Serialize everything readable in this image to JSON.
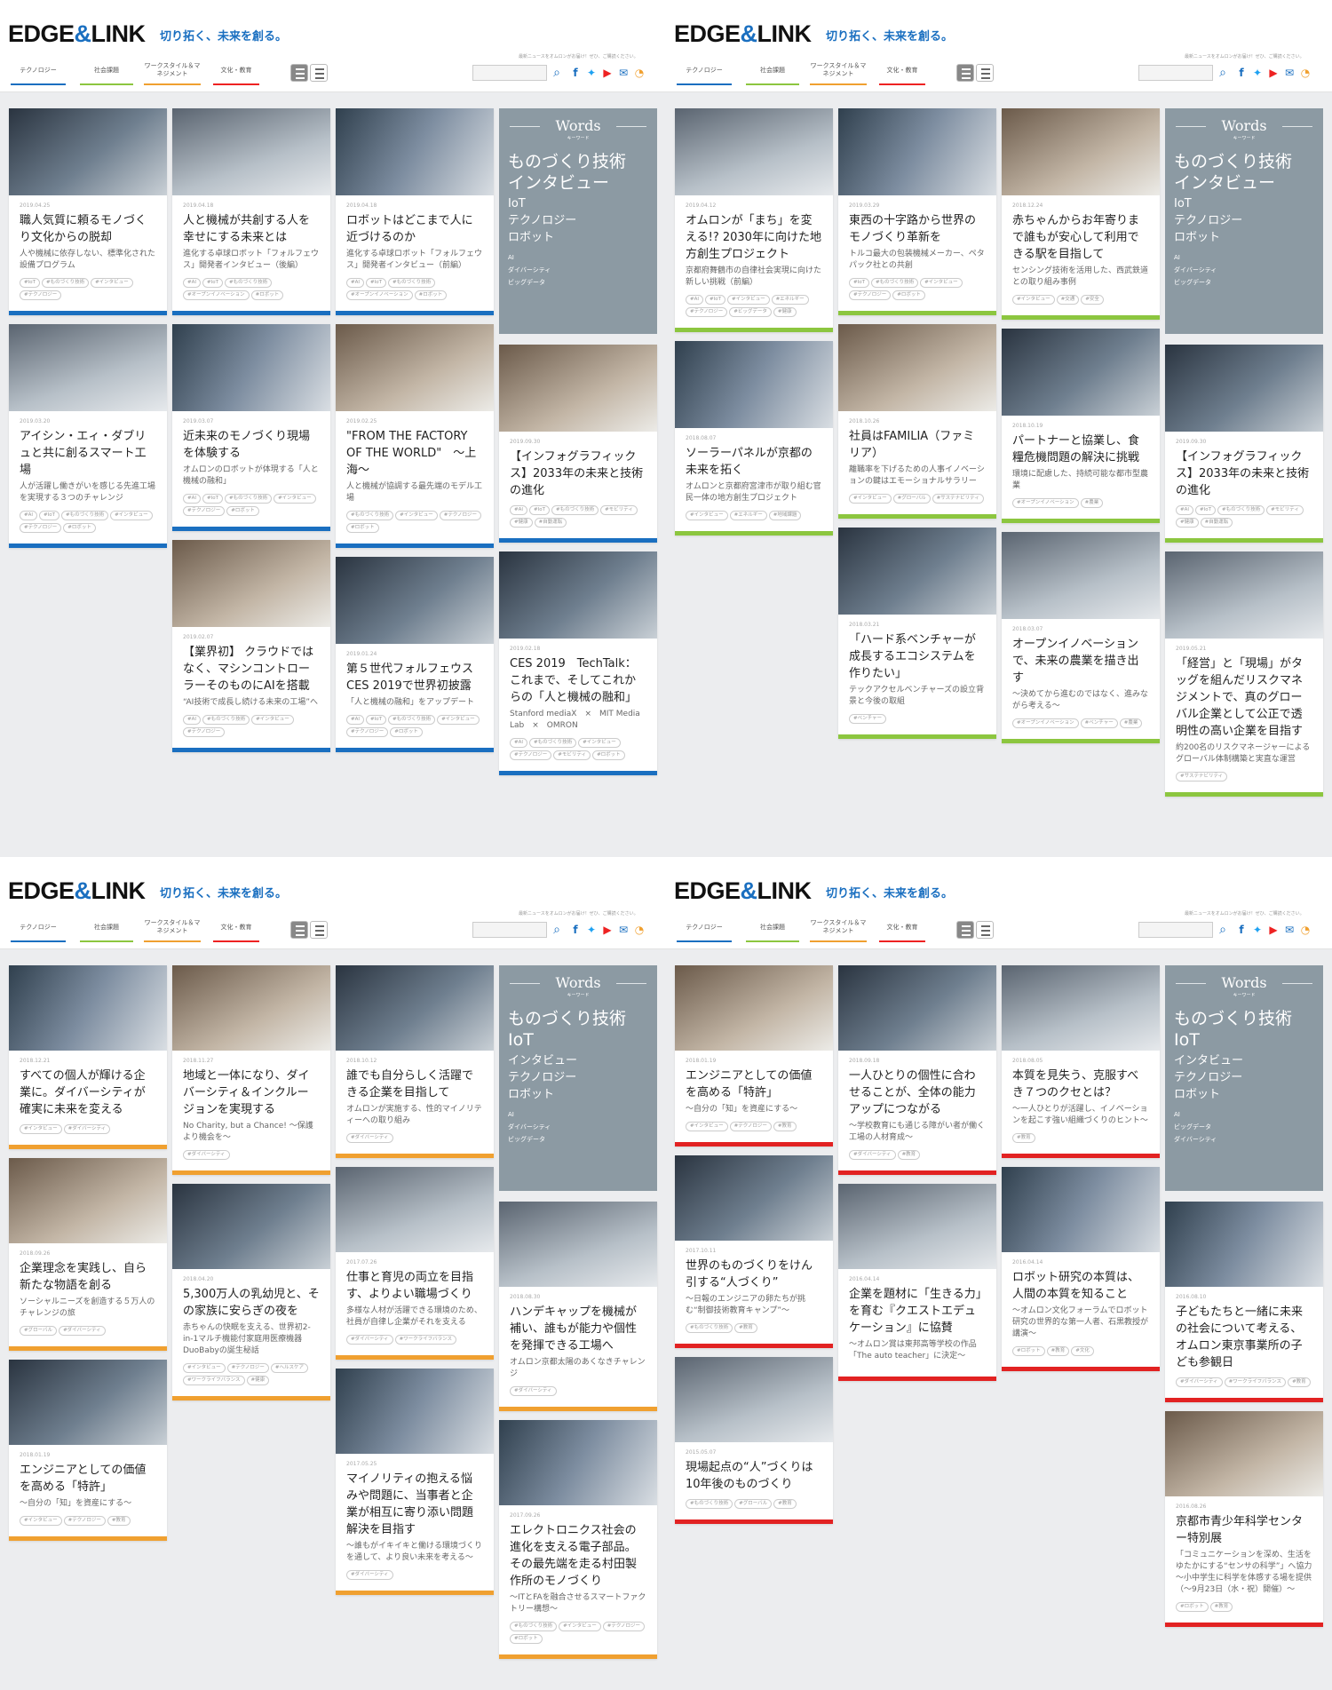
{
  "site": {
    "logo": "EDGE",
    "amp": "&",
    "logo2": "LINK",
    "tagline": "切り拓く、未来を創る。",
    "note": "最新ニュースをオムロンがお届け！ぜひ、ご購読ください。",
    "nav": [
      "テクノロジー",
      "社会課題",
      "ワークスタイル＆マネジメント",
      "文化・教育"
    ],
    "icons": [
      "search-icon",
      "facebook-icon",
      "twitter-icon",
      "youtube-icon",
      "mail-icon",
      "rss-icon"
    ],
    "colors": {
      "tech": "#1a6fc0",
      "social": "#8cc63f",
      "work": "#f0a030",
      "culture": "#e22222"
    }
  },
  "words": {
    "q1": {
      "en": "Words",
      "jp": "キーワード",
      "lg": [
        "ものづくり技術",
        "インタビュー"
      ],
      "md": [
        "IoT",
        "テクノロジー",
        "ロボット"
      ],
      "sm": [
        "AI",
        "ダイバーシティ",
        "ビッグデータ"
      ]
    },
    "q2": {
      "en": "Words",
      "jp": "キーワード",
      "lg": [
        "ものづくり技術",
        "インタビュー"
      ],
      "md": [
        "IoT",
        "テクノロジー",
        "ロボット"
      ],
      "sm": [
        "AI",
        "ダイバーシティ",
        "ビッグデータ"
      ]
    },
    "q3": {
      "en": "Words",
      "jp": "キーワード",
      "lg": [
        "ものづくり技術",
        "IoT"
      ],
      "md": [
        "インタビュー",
        "テクノロジー",
        "ロボット"
      ],
      "sm": [
        "AI",
        "ダイバーシティ",
        "ビッグデータ"
      ]
    },
    "q4": {
      "en": "Words",
      "jp": "キーワード",
      "lg": [
        "ものづくり技術",
        "IoT"
      ],
      "md": [
        "インタビュー",
        "テクノロジー",
        "ロボット"
      ],
      "sm": [
        "AI",
        "ビッグデータ",
        "ダイバーシティ"
      ]
    }
  },
  "cards": {
    "q1": [
      [
        {
          "d": "2019.04.25",
          "t": "職人気質に頼るモノづくり文化からの脱却",
          "s": "人や機械に依存しない、標準化された設備プログラム",
          "tg": [
            "#IoT",
            "#ものづくり技術",
            "#インタビュー",
            "#テクノロジー"
          ]
        },
        {
          "d": "2019.03.20",
          "t": "アイシン・エィ・ダブリュと共に創るスマート工場",
          "s": "人が活躍し働きがいを感じる先進工場を実現する３つのチャレンジ",
          "tg": [
            "#AI",
            "#IoT",
            "#ものづくり技術",
            "#インタビュー",
            "#テクノロジー",
            "#ロボット"
          ]
        }
      ],
      [
        {
          "d": "2019.04.18",
          "t": "人と機械が共創する人を幸せにする未来とは",
          "s": "進化する卓球ロボット「フォルフェウス」開発者インタビュー（後編）",
          "tg": [
            "#AI",
            "#IoT",
            "#ものづくり技術",
            "#オープンイノベーション",
            "#ロボット"
          ]
        },
        {
          "d": "2019.03.07",
          "t": "近未来のモノづくり現場を体験する",
          "s": "オムロンのロボットが体現する「人と機械の融和」",
          "tg": [
            "#AI",
            "#IoT",
            "#ものづくり技術",
            "#インタビュー",
            "#テクノロジー",
            "#ロボット"
          ]
        },
        {
          "d": "2019.02.07",
          "t": "【業界初】 クラウドではなく、マシンコントローラーそのものにAIを搭載",
          "s": "“AI技術で成長し続ける未来の工場”へ",
          "tg": [
            "#AI",
            "#ものづくり技術",
            "#インタビュー",
            "#テクノロジー"
          ]
        }
      ],
      [
        {
          "d": "2019.04.18",
          "t": "ロボットはどこまで人に近づけるのか",
          "s": "進化する卓球ロボット「フォルフェウス」開発者インタビュー（前編）",
          "tg": [
            "#AI",
            "#IoT",
            "#ものづくり技術",
            "#オープンイノベーション",
            "#ロボット"
          ]
        },
        {
          "d": "2019.02.25",
          "t": "\"FROM THE FACTORY OF THE WORLD\"　～上海～",
          "s": "人と機械が協調する最先端のモデル工場",
          "tg": [
            "#ものづくり技術",
            "#インタビュー",
            "#テクノロジー",
            "#ロボット"
          ]
        },
        {
          "d": "2019.01.24",
          "t": "第５世代フォルフェウス　CES 2019で世界初披露",
          "s": "「人と機械の融和」をアップデート",
          "tg": [
            "#AI",
            "#IoT",
            "#ものづくり技術",
            "#インタビュー",
            "#テクノロジー",
            "#ロボット"
          ]
        }
      ],
      [
        {
          "d": "2019.09.30",
          "t": "【インフォグラフィックス】2033年の未来と技術の進化",
          "s": "",
          "tg": [
            "#AI",
            "#IoT",
            "#ものづくり技術",
            "#モビリティ",
            "#健康",
            "#自動運転"
          ]
        },
        {
          "d": "2019.02.18",
          "t": "CES 2019　TechTalk：これまで、そしてこれからの「人と機械の融和」",
          "s": "Stanford mediaX　×　MIT Media Lab　×　OMRON",
          "tg": [
            "#AI",
            "#ものづくり技術",
            "#インタビュー",
            "#テクノロジー",
            "#モビリティ",
            "#ロボット"
          ]
        }
      ]
    ],
    "q2": [
      [
        {
          "d": "2019.04.12",
          "t": "オムロンが「まち」を変える!? 2030年に向けた地方創生プロジェクト",
          "s": "京都府舞鶴市の自律社会実現に向けた新しい挑戦（前編）",
          "tg": [
            "#AI",
            "#IoT",
            "#インタビュー",
            "#エネルギー",
            "#テクノロジー",
            "#ビッグデータ",
            "#健康"
          ]
        },
        {
          "d": "2018.08.07",
          "t": "ソーラーパネルが京都の未来を拓く",
          "s": "オムロンと京都府宮津市が取り組む官民一体の地方創生プロジェクト",
          "tg": [
            "#インタビュー",
            "#エネルギー",
            "#地域課題"
          ]
        }
      ],
      [
        {
          "d": "2019.03.29",
          "t": "東西の十字路から世界のモノづくり革新を",
          "s": "トルコ最大の包装機械メーカー、ペタパック社との共創",
          "tg": [
            "#IoT",
            "#ものづくり技術",
            "#インタビュー",
            "#テクノロジー",
            "#ロボット"
          ]
        },
        {
          "d": "2018.10.26",
          "t": "社員はFAMILIA（ファミリア）",
          "s": "離職率を下げるための人事イノベーションの鍵はエモーショナルサラリー",
          "tg": [
            "#インタビュー",
            "#グローバル",
            "#サステナビリティ"
          ]
        },
        {
          "d": "2018.03.21",
          "t": "「ハード系ベンチャーが成長するエコシステムを作りたい」",
          "s": "テックアクセルベンチャーズの設立背景と今後の取組",
          "tg": [
            "#ベンチャー"
          ]
        }
      ],
      [
        {
          "d": "2018.12.24",
          "t": "赤ちゃんからお年寄りまで誰もが安心して利用できる駅を目指して",
          "s": "センシング技術を活用した、西武鉄道との取り組み事例",
          "tg": [
            "#インタビュー",
            "#交通",
            "#安全"
          ]
        },
        {
          "d": "2018.10.19",
          "t": "パートナーと協業し、食糧危機問題の解決に挑戦",
          "s": "環境に配慮した、持続可能な都市型農業",
          "tg": [
            "#オープンイノベーション",
            "#農業"
          ]
        },
        {
          "d": "2018.03.07",
          "t": "オープンイノベーションで、未来の農業を描き出す",
          "s": "～決めてから進むのではなく、進みながら考える～",
          "tg": [
            "#オープンイノベーション",
            "#ベンチャー",
            "#農業"
          ]
        }
      ],
      [
        {
          "d": "2019.09.30",
          "t": "【インフォグラフィックス】2033年の未来と技術の進化",
          "s": "",
          "tg": [
            "#AI",
            "#IoT",
            "#ものづくり技術",
            "#モビリティ",
            "#健康",
            "#自動運転"
          ]
        },
        {
          "d": "2019.05.21",
          "t": "「経営」と「現場」がタッグを組んだリスクマネジメントで、真のグローバル企業として公正で透明性の高い企業を目指す",
          "s": "約200名のリスクマネージャーによるグローバル体制構築と実直な運営",
          "tg": [
            "#サステナビリティ"
          ]
        }
      ]
    ],
    "q3": [
      [
        {
          "d": "2018.12.21",
          "t": "すべての個人が輝ける企業に。ダイバーシティが確実に未来を変える",
          "s": "",
          "tg": [
            "#インタビュー",
            "#ダイバーシティ"
          ]
        },
        {
          "d": "2018.09.26",
          "t": "企業理念を実践し、自ら新たな物語を創る",
          "s": "ソーシャルニーズを創造する５万人のチャレンジの旅",
          "tg": [
            "#グローバル",
            "#ダイバーシティ"
          ]
        },
        {
          "d": "2018.01.19",
          "t": "エンジニアとしての価値を高める「特許」",
          "s": "～自分の「知」を資産にする～",
          "tg": [
            "#インタビュー",
            "#テクノロジー",
            "#教育"
          ]
        }
      ],
      [
        {
          "d": "2018.11.27",
          "t": "地域と一体になり、ダイバーシティ＆インクルージョンを実現する",
          "s": "No Charity, but a Chance! ～保護より機会を～",
          "tg": [
            "#ダイバーシティ"
          ]
        },
        {
          "d": "2018.04.20",
          "t": "5,300万人の乳幼児と、その家族に安らぎの夜を",
          "s": "赤ちゃんの快眠を支える、世界初2-in-1マルチ機能付家庭用医療機器DuoBabyの誕生秘話",
          "tg": [
            "#インタビュー",
            "#テクノロジー",
            "#ヘルスケア",
            "#ワークライフバランス",
            "#健康"
          ]
        }
      ],
      [
        {
          "d": "2018.10.12",
          "t": "誰でも自分らしく活躍できる企業を目指して",
          "s": "オムロンが実施する、性的マイノリティーへの取り組み",
          "tg": [
            "#ダイバーシティ"
          ]
        },
        {
          "d": "2017.07.26",
          "t": "仕事と育児の両立を目指す、よりよい職場づくり",
          "s": "多様な人材が活躍できる環境のため、社員が自律し企業がそれを支える",
          "tg": [
            "#ダイバーシティ",
            "#ワークライフバランス"
          ]
        },
        {
          "d": "2017.05.25",
          "t": "マイノリティの抱える悩みや問題に、当事者と企業が相互に寄り添い問題解決を目指す",
          "s": "～誰もがイキイキと働ける環境づくりを通して、より良い未来を考える～",
          "tg": [
            "#ダイバーシティ"
          ]
        }
      ],
      [
        {
          "d": "2018.08.30",
          "t": "ハンデキャップを機械が補い、誰もが能力や個性を発揮できる工場へ",
          "s": "オムロン京都太陽のあくなきチャレンジ",
          "tg": [
            "#ダイバーシティ"
          ]
        },
        {
          "d": "2017.09.26",
          "t": "エレクトロニクス社会の進化を支える電子部品。その最先端を走る村田製作所のモノづくり",
          "s": "～ITとFAを融合させるスマートファクトリー構想～",
          "tg": [
            "#ものづくり技術",
            "#インタビュー",
            "#テクノロジー",
            "#ロボット"
          ]
        }
      ]
    ],
    "q4": [
      [
        {
          "d": "2018.01.19",
          "t": "エンジニアとしての価値を高める「特許」",
          "s": "～自分の「知」を資産にする～",
          "tg": [
            "#インタビュー",
            "#テクノロジー",
            "#教育"
          ]
        },
        {
          "d": "2017.10.11",
          "t": "世界のものづくりをけん引する“人づくり”",
          "s": "～日報のエンジニアの卵たちが挑む“制御技術教育キャンプ”～",
          "tg": [
            "#ものづくり技術",
            "#教育"
          ]
        },
        {
          "d": "2015.05.07",
          "t": "現場起点の“人”づくりは10年後のものづくり",
          "s": "",
          "tg": [
            "#ものづくり技術",
            "#グローバル",
            "#教育"
          ]
        }
      ],
      [
        {
          "d": "2018.09.18",
          "t": "一人ひとりの個性に合わせることが、全体の能力アップにつながる",
          "s": "～学校教育にも通じる障がい者が働く工場の人材育成～",
          "tg": [
            "#ダイバーシティ",
            "#教育"
          ]
        },
        {
          "d": "2016.04.14",
          "t": "企業を題材に「生きる力」を育む『クエストエデュケーション』に協賛",
          "s": "～オムロン賞は東邦高等学校の作品「The auto teacher」に決定～",
          "tg": []
        }
      ],
      [
        {
          "d": "2018.08.05",
          "t": "本質を見失う、克服すべき７つのクセとは？",
          "s": "～一人ひとりが活躍し、イノベーションを起こす強い組織づくりのヒント～",
          "tg": [
            "#教育"
          ]
        },
        {
          "d": "2016.04.14",
          "t": "ロボット研究の本質は、人間の本質を知ること",
          "s": "～オムロン文化フォーラムでロボット研究の世界的な第一人者、石黒教授が講演～",
          "tg": [
            "#ロボット",
            "#教育",
            "#文化"
          ]
        }
      ],
      [
        {
          "d": "2016.08.10",
          "t": "子どもたちと一緒に未来の社会について考える、オムロン東京事業所の子ども参観日",
          "s": "",
          "tg": [
            "#ダイバーシティ",
            "#ワークライフバランス",
            "#教育"
          ]
        },
        {
          "d": "2016.08.26",
          "t": "京都市青少年科学センター特別展",
          "s": "「コミュニケーションを深め、生活をゆたかにする“センサの科学”」へ協力 ～小中学生に科学を体感する場を提供（～9月23日（水・祝）開催）～",
          "tg": [
            "#ロボット",
            "#教育"
          ]
        }
      ]
    ]
  }
}
